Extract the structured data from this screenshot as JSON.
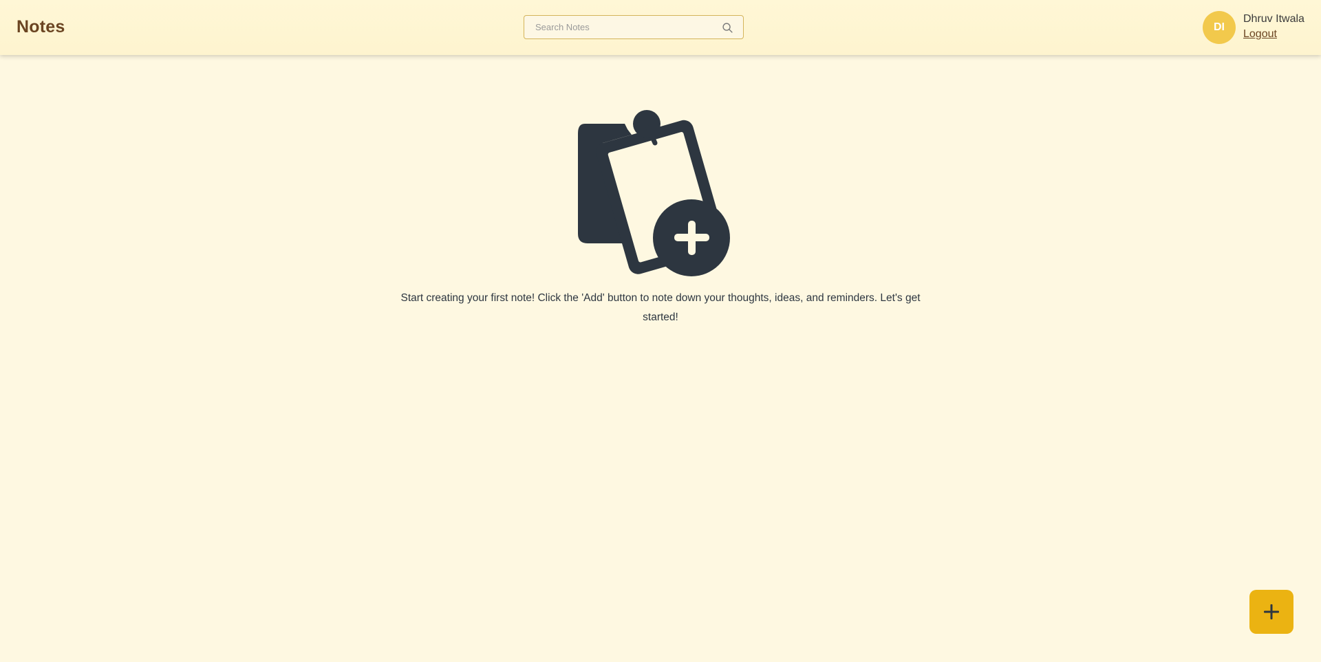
{
  "navbar": {
    "title": "Notes",
    "search": {
      "placeholder": "Search Notes",
      "value": "",
      "icon": "search-icon"
    },
    "user": {
      "initials": "DI",
      "name": "Dhruv Itwala",
      "logout_label": "Logout"
    }
  },
  "empty_state": {
    "icon": "add-note-icon",
    "message": "Start creating your first note! Click the 'Add' button to note down your thoughts, ideas, and reminders. Let's get started!"
  },
  "fab": {
    "icon": "plus-icon"
  },
  "colors": {
    "background": "#fef8e1",
    "brand_text": "#6b4522",
    "avatar": "#f2c94c",
    "fab": "#ebb312",
    "illustration": "#2d3640"
  }
}
